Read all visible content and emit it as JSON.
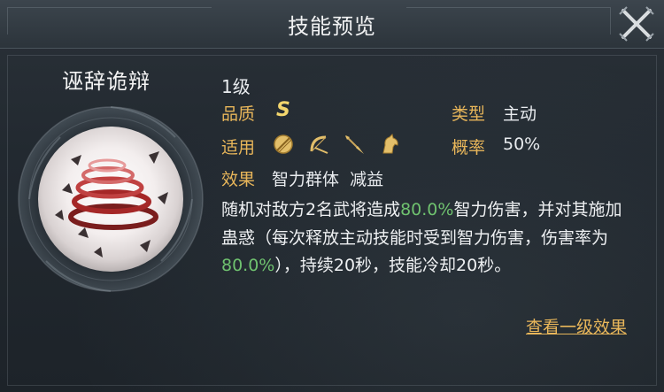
{
  "dialog": {
    "title": "技能预览",
    "close_icon": "crossed-swords-close-icon"
  },
  "skill": {
    "name": "诬辞诡辩",
    "icon": "spiral-whirlwind-orb",
    "level": "1级",
    "quality_label": "品质",
    "quality_value": "S",
    "type_label": "类型",
    "type_value": "主动",
    "applicable_label": "适用",
    "applicable_icons": [
      "shield-icon",
      "bow-icon",
      "spear-icon",
      "horse-icon"
    ],
    "rate_label": "概率",
    "rate_value": "50%",
    "effect_label": "效果",
    "effect_tags": "智力群体  减益",
    "description": {
      "part1": "随机对敌方2名武将造成",
      "value1": "80.0%",
      "part2": "智力伤害，并对其施加蛊惑（每次释放主动技能时受到智力伤害，伤害率为",
      "value2": "80.0%",
      "part3": "），持续20秒，技能冷却20秒。"
    },
    "view_level1_link": "查看一级效果"
  },
  "colors": {
    "label_gold": "#e8b65a",
    "highlight_green": "#6fc26f",
    "grade_gold": "#f3d66d"
  }
}
